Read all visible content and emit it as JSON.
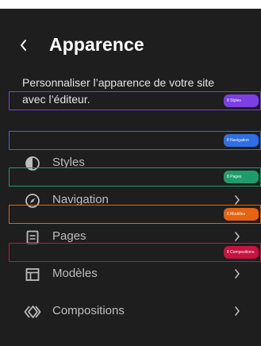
{
  "header": {
    "back_icon": "chevron-left-icon",
    "title": "Apparence"
  },
  "description": "Personnaliser l’apparence de votre site avec l’éditeur.",
  "menu": {
    "items": [
      {
        "label": "Styles",
        "icon": "half-circle-icon",
        "has_chevron": false
      },
      {
        "label": "Navigation",
        "icon": "compass-icon",
        "has_chevron": true
      },
      {
        "label": "Pages",
        "icon": "page-icon",
        "has_chevron": true
      },
      {
        "label": "Modèles",
        "icon": "layout-icon",
        "has_chevron": true
      },
      {
        "label": "Compositions",
        "icon": "diamond-outline-icon",
        "has_chevron": true
      }
    ]
  },
  "annotations": [
    {
      "tag": "8 Styles",
      "color": "#7b3fe4"
    },
    {
      "tag": "8 Navigation",
      "color": "#2f6fe4"
    },
    {
      "tag": "8 Pages",
      "color": "#1e9c6a"
    },
    {
      "tag": "8 Modèles",
      "color": "#e8620f"
    },
    {
      "tag": "8 Compositions",
      "color": "#c8123f"
    }
  ],
  "colors": {
    "background": "#1e1e1e",
    "text_primary": "#ffffff",
    "text_secondary": "#bdbdbd"
  }
}
